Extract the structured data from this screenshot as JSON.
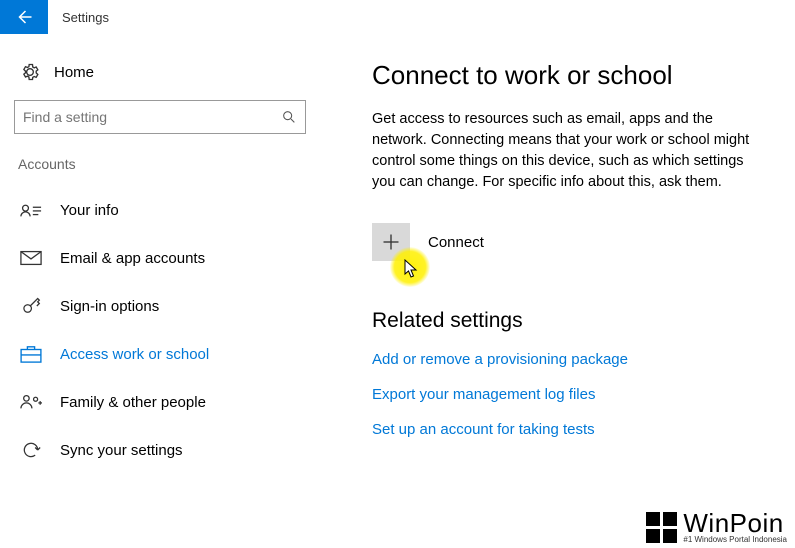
{
  "app_title": "Settings",
  "sidebar": {
    "home_label": "Home",
    "search_placeholder": "Find a setting",
    "category": "Accounts",
    "items": [
      {
        "label": "Your info"
      },
      {
        "label": "Email & app accounts"
      },
      {
        "label": "Sign-in options"
      },
      {
        "label": "Access work or school"
      },
      {
        "label": "Family & other people"
      },
      {
        "label": "Sync your settings"
      }
    ]
  },
  "main": {
    "title": "Connect to work or school",
    "description": "Get access to resources such as email, apps and the network. Connecting means that your work or school might control some things on this device, such as which settings you can change. For specific info about this, ask them.",
    "connect_label": "Connect",
    "related_title": "Related settings",
    "links": [
      "Add or remove a provisioning package",
      "Export your management log files",
      "Set up an account for taking tests"
    ]
  },
  "watermark": {
    "name": "WinPoin",
    "tagline": "#1 Windows Portal Indonesia"
  }
}
